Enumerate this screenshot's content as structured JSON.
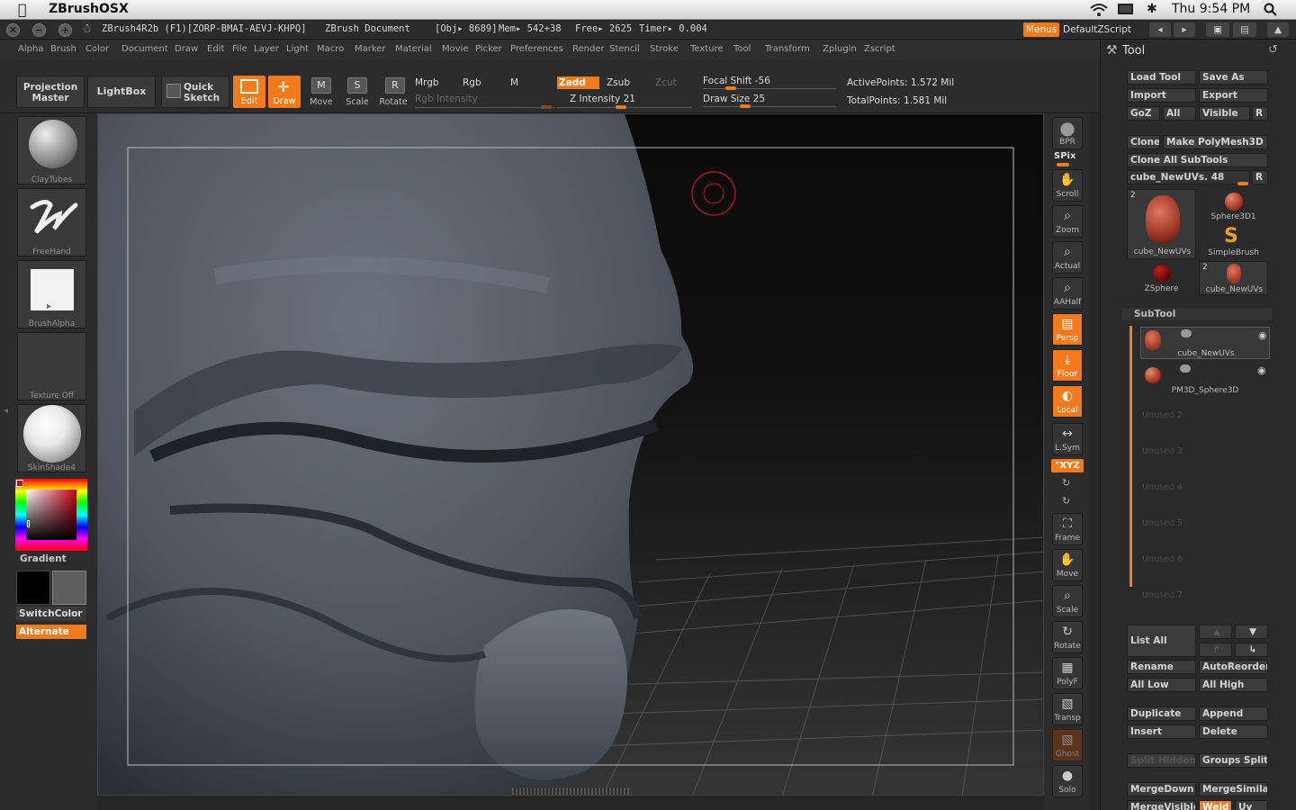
{
  "macbar": {
    "app_name": "ZBrushOSX",
    "clock": "Thu 9:54 PM"
  },
  "titlebar": {
    "version": "ZBrush4R2b (F1)[ZORP-BMAI-AEVJ-KHPQ]",
    "document": "ZBrush Document",
    "obj": "[Obj▸ 8689]",
    "mem": "Mem▸ 542+38",
    "free": "Free▸ 2625",
    "timer": "Timer▸ 0.004",
    "menus_label": "Menus",
    "script_label": "DefaultZScript"
  },
  "menubar": {
    "items": [
      "Alpha",
      "Brush",
      "Color",
      "Document",
      "Draw",
      "Edit",
      "File",
      "Layer",
      "Light",
      "Macro",
      "Marker",
      "Material",
      "Movie",
      "Picker",
      "Preferences",
      "Render",
      "Stencil",
      "Stroke",
      "Texture",
      "Tool",
      "Transform",
      "Zplugin",
      "Zscript"
    ]
  },
  "shelf": {
    "projection_master": "Projection Master",
    "lightbox": "LightBox",
    "quick_sketch": "Quick Sketch",
    "edit": "Edit",
    "draw": "Draw",
    "move": "Move",
    "scale": "Scale",
    "rotate": "Rotate",
    "mrgb": "Mrgb",
    "rgb": "Rgb",
    "m": "M",
    "rgb_intensity": "Rgb Intensity",
    "zadd": "Zadd",
    "zsub": "Zsub",
    "zcut": "Zcut",
    "z_intensity": "Z Intensity 21",
    "focal_shift": "Focal Shift -56",
    "draw_size": "Draw Size 25",
    "active_points": "ActivePoints: 1.572 Mil",
    "total_points": "TotalPoints: 1.581 Mil"
  },
  "lefttray": {
    "brush": "ClayTubes",
    "stroke": "FreeHand",
    "alpha": "BrushAlpha",
    "texture": "Texture Off",
    "material": "SkinShade4",
    "gradient": "Gradient",
    "switchcolor": "SwitchColor",
    "alternate": "Alternate"
  },
  "righttools": [
    {
      "key": "bpr",
      "label": "BPR"
    },
    {
      "key": "spix",
      "label": "SPix"
    },
    {
      "key": "scroll",
      "label": "Scroll"
    },
    {
      "key": "zoom",
      "label": "Zoom"
    },
    {
      "key": "actual",
      "label": "Actual"
    },
    {
      "key": "aahalf",
      "label": "AAHalf"
    },
    {
      "key": "persp",
      "label": "Persp"
    },
    {
      "key": "floor",
      "label": "Floor"
    },
    {
      "key": "local",
      "label": "Local"
    },
    {
      "key": "lsym",
      "label": "L.Sym"
    },
    {
      "key": "xyz",
      "label": "°XYZ"
    },
    {
      "key": "frame",
      "label": "Frame"
    },
    {
      "key": "move",
      "label": "Move"
    },
    {
      "key": "scale",
      "label": "Scale"
    },
    {
      "key": "rotate",
      "label": "Rotate"
    },
    {
      "key": "polyf",
      "label": "PolyF"
    },
    {
      "key": "transp",
      "label": "Transp"
    },
    {
      "key": "ghost",
      "label": "Ghost"
    },
    {
      "key": "solo",
      "label": "Solo"
    }
  ],
  "toolpanel": {
    "title": "Tool",
    "load_tool": "Load Tool",
    "save_as": "Save As",
    "import": "Import",
    "export": "Export",
    "goz": "GoZ",
    "all": "All",
    "visible": "Visible",
    "r": "R",
    "clone": "Clone",
    "make_polymesh": "Make PolyMesh3D",
    "clone_all": "Clone All SubTools",
    "current_tool": "cube_NewUVs. 48",
    "thumbs": {
      "t1": "cube_NewUVs",
      "t1_count": "2",
      "t2": "Sphere3D1",
      "t3": "SimpleBrush",
      "t4": "ZSphere",
      "t5": "cube_NewUVs",
      "t5_count": "2"
    },
    "subtool_header": "SubTool",
    "subtools": [
      "cube_NewUVs",
      "PM3D_Sphere3D"
    ],
    "unused": [
      "Unused 2",
      "Unused 3",
      "Unused 4",
      "Unused 5",
      "Unused 6",
      "Unused 7"
    ],
    "list_all": "List All",
    "rename": "Rename",
    "autoreorder": "AutoReorder",
    "all_low": "All Low",
    "all_high": "All High",
    "duplicate": "Duplicate",
    "append": "Append",
    "insert": "Insert",
    "delete": "Delete",
    "split_hidden": "Split Hidden",
    "groups_split": "Groups Split",
    "merge_down": "MergeDown",
    "merge_similar": "MergeSimilar",
    "merge_visible": "MergeVisible",
    "weld": "Weld",
    "uv": "Uv"
  },
  "colors": {
    "accent": "#f47b1c",
    "panel": "#2c2c2c",
    "clay": "#5f6670"
  }
}
